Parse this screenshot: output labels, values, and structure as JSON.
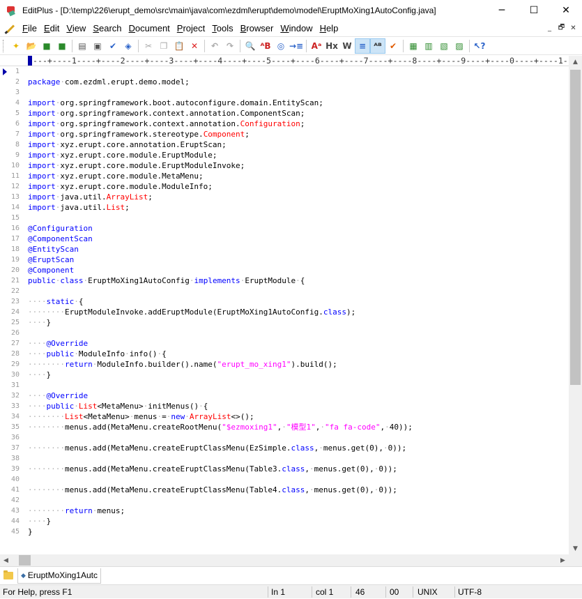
{
  "window": {
    "title": "EditPlus - [D:\\temp\\226\\erupt_demo\\src\\main\\java\\com\\ezdml\\erupt\\demo\\model\\EruptMoXing1AutoConfig.java]",
    "minimize": "─",
    "maximize": "☐",
    "close": "✕"
  },
  "menu": {
    "items": [
      {
        "u": "F",
        "rest": "ile"
      },
      {
        "u": "E",
        "rest": "dit"
      },
      {
        "u": "V",
        "rest": "iew"
      },
      {
        "u": "S",
        "rest": "earch"
      },
      {
        "u": "D",
        "rest": "ocument"
      },
      {
        "u": "P",
        "rest": "roject"
      },
      {
        "u": "T",
        "rest": "ools"
      },
      {
        "u": "B",
        "rest": "rowser"
      },
      {
        "u": "W",
        "rest": "indow"
      },
      {
        "u": "H",
        "rest": "elp"
      }
    ],
    "mdi": [
      "_",
      "🗗",
      "✕"
    ]
  },
  "toolbar": {
    "buttons": [
      {
        "icon": "new-file-icon",
        "glyph": "✦",
        "color": "#e8b800"
      },
      {
        "icon": "open-folder-icon",
        "glyph": "📂",
        "color": "#e0a020"
      },
      {
        "icon": "save-icon",
        "glyph": "■",
        "color": "#2b8a2b"
      },
      {
        "icon": "save-all-icon",
        "glyph": "■",
        "color": "#2b8a2b"
      },
      {
        "sep": true
      },
      {
        "icon": "print-preview-icon",
        "glyph": "▤",
        "color": "#555"
      },
      {
        "icon": "print-icon",
        "glyph": "▣",
        "color": "#555"
      },
      {
        "icon": "spell-check-icon",
        "glyph": "✔",
        "color": "#2a62c9"
      },
      {
        "icon": "browser-view-icon",
        "glyph": "◈",
        "color": "#2a62c9"
      },
      {
        "sep": true
      },
      {
        "icon": "cut-icon",
        "glyph": "✂",
        "color": "#aaa"
      },
      {
        "icon": "copy-icon",
        "glyph": "❐",
        "color": "#aaa"
      },
      {
        "icon": "paste-icon",
        "glyph": "📋",
        "color": "#aaa"
      },
      {
        "icon": "delete-icon",
        "glyph": "✕",
        "color": "#d22"
      },
      {
        "sep": true
      },
      {
        "icon": "undo-icon",
        "glyph": "↶",
        "color": "#aaa"
      },
      {
        "icon": "redo-icon",
        "glyph": "↷",
        "color": "#aaa"
      },
      {
        "sep": true
      },
      {
        "icon": "find-icon",
        "glyph": "🔍",
        "color": "#333"
      },
      {
        "icon": "replace-icon",
        "glyph": "ᴬB",
        "color": "#c22"
      },
      {
        "icon": "find-in-files-icon",
        "glyph": "◎",
        "color": "#2a62c9"
      },
      {
        "icon": "goto-line-icon",
        "glyph": "→≡",
        "color": "#2a62c9"
      },
      {
        "sep": true
      },
      {
        "icon": "font-icon",
        "glyph": "Aᵃ",
        "color": "#c22"
      },
      {
        "icon": "hex-view-icon",
        "glyph": "Hx",
        "color": "#444"
      },
      {
        "icon": "word-wrap-icon",
        "glyph": "W",
        "color": "#444"
      },
      {
        "icon": "line-number-icon",
        "glyph": "≡",
        "color": "#2a62c9",
        "active": true
      },
      {
        "icon": "column-marker-icon",
        "glyph": "ᴬᴮ",
        "color": "#333",
        "active": true
      },
      {
        "icon": "check-icon",
        "glyph": "✔",
        "color": "#e05a00"
      },
      {
        "sep": true
      },
      {
        "icon": "cliptext-icon",
        "glyph": "▦",
        "color": "#2b8a2b"
      },
      {
        "icon": "directory-icon",
        "glyph": "▥",
        "color": "#2b8a2b"
      },
      {
        "icon": "html-toolbar-icon",
        "glyph": "▧",
        "color": "#2b8a2b"
      },
      {
        "icon": "window-list-icon",
        "glyph": "▨",
        "color": "#2b8a2b"
      },
      {
        "sep": true
      },
      {
        "icon": "context-help-icon",
        "glyph": "↖?",
        "color": "#2a62c9"
      }
    ]
  },
  "ruler": "----+----1----+----2----+----3----+----4----+----5----+----6----+----7----+----8----+----9----+----0----+----1-",
  "code_lines": [
    [],
    [
      [
        "k",
        "package"
      ],
      [
        "d",
        "·"
      ],
      [
        "t",
        "com.ezdml.erupt.demo.model;"
      ]
    ],
    [],
    [
      [
        "k",
        "import"
      ],
      [
        "d",
        "·"
      ],
      [
        "t",
        "org.springframework.boot.autoconfigure.domain.EntityScan;"
      ]
    ],
    [
      [
        "k",
        "import"
      ],
      [
        "d",
        "·"
      ],
      [
        "t",
        "org.springframework.context.annotation.ComponentScan;"
      ]
    ],
    [
      [
        "k",
        "import"
      ],
      [
        "d",
        "·"
      ],
      [
        "t",
        "org.springframework.context.annotation."
      ],
      [
        "r",
        "Configuration"
      ],
      [
        "t",
        ";"
      ]
    ],
    [
      [
        "k",
        "import"
      ],
      [
        "d",
        "·"
      ],
      [
        "t",
        "org.springframework.stereotype."
      ],
      [
        "r",
        "Component"
      ],
      [
        "t",
        ";"
      ]
    ],
    [
      [
        "k",
        "import"
      ],
      [
        "d",
        "·"
      ],
      [
        "t",
        "xyz.erupt.core.annotation.EruptScan;"
      ]
    ],
    [
      [
        "k",
        "import"
      ],
      [
        "d",
        "·"
      ],
      [
        "t",
        "xyz.erupt.core.module.EruptModule;"
      ]
    ],
    [
      [
        "k",
        "import"
      ],
      [
        "d",
        "·"
      ],
      [
        "t",
        "xyz.erupt.core.module.EruptModuleInvoke;"
      ]
    ],
    [
      [
        "k",
        "import"
      ],
      [
        "d",
        "·"
      ],
      [
        "t",
        "xyz.erupt.core.module.MetaMenu;"
      ]
    ],
    [
      [
        "k",
        "import"
      ],
      [
        "d",
        "·"
      ],
      [
        "t",
        "xyz.erupt.core.module.ModuleInfo;"
      ]
    ],
    [
      [
        "k",
        "import"
      ],
      [
        "d",
        "·"
      ],
      [
        "t",
        "java.util."
      ],
      [
        "r",
        "ArrayList"
      ],
      [
        "t",
        ";"
      ]
    ],
    [
      [
        "k",
        "import"
      ],
      [
        "d",
        "·"
      ],
      [
        "t",
        "java.util."
      ],
      [
        "r",
        "List"
      ],
      [
        "t",
        ";"
      ]
    ],
    [],
    [
      [
        "k",
        "@Configuration"
      ]
    ],
    [
      [
        "k",
        "@ComponentScan"
      ]
    ],
    [
      [
        "k",
        "@EntityScan"
      ]
    ],
    [
      [
        "k",
        "@EruptScan"
      ]
    ],
    [
      [
        "k",
        "@Component"
      ]
    ],
    [
      [
        "k",
        "public"
      ],
      [
        "d",
        "·"
      ],
      [
        "k",
        "class"
      ],
      [
        "d",
        "·"
      ],
      [
        "t",
        "EruptMoXing1AutoConfig"
      ],
      [
        "d",
        "·"
      ],
      [
        "k",
        "implements"
      ],
      [
        "d",
        "·"
      ],
      [
        "t",
        "EruptModule"
      ],
      [
        "d",
        "·"
      ],
      [
        "t",
        "{"
      ]
    ],
    [],
    [
      [
        "d",
        "····"
      ],
      [
        "k",
        "static"
      ],
      [
        "d",
        "·"
      ],
      [
        "t",
        "{"
      ]
    ],
    [
      [
        "d",
        "········"
      ],
      [
        "t",
        "EruptModuleInvoke.addEruptModule(EruptMoXing1AutoConfig."
      ],
      [
        "k",
        "class"
      ],
      [
        "t",
        ");"
      ]
    ],
    [
      [
        "d",
        "····"
      ],
      [
        "t",
        "}"
      ]
    ],
    [],
    [
      [
        "d",
        "····"
      ],
      [
        "k",
        "@Override"
      ]
    ],
    [
      [
        "d",
        "····"
      ],
      [
        "k",
        "public"
      ],
      [
        "d",
        "·"
      ],
      [
        "t",
        "ModuleInfo"
      ],
      [
        "d",
        "·"
      ],
      [
        "t",
        "info()"
      ],
      [
        "d",
        "·"
      ],
      [
        "t",
        "{"
      ]
    ],
    [
      [
        "d",
        "········"
      ],
      [
        "k",
        "return"
      ],
      [
        "d",
        "·"
      ],
      [
        "t",
        "ModuleInfo.builder().name("
      ],
      [
        "s",
        "\"erupt_mo_xing1\""
      ],
      [
        "t",
        ").build();"
      ]
    ],
    [
      [
        "d",
        "····"
      ],
      [
        "t",
        "}"
      ]
    ],
    [],
    [
      [
        "d",
        "····"
      ],
      [
        "k",
        "@Override"
      ]
    ],
    [
      [
        "d",
        "····"
      ],
      [
        "k",
        "public"
      ],
      [
        "d",
        "·"
      ],
      [
        "r",
        "List"
      ],
      [
        "t",
        "<MetaMenu>"
      ],
      [
        "d",
        "·"
      ],
      [
        "t",
        "initMenus()"
      ],
      [
        "d",
        "·"
      ],
      [
        "t",
        "{"
      ]
    ],
    [
      [
        "d",
        "········"
      ],
      [
        "r",
        "List"
      ],
      [
        "t",
        "<MetaMenu>"
      ],
      [
        "d",
        "·"
      ],
      [
        "t",
        "menus"
      ],
      [
        "d",
        "·"
      ],
      [
        "t",
        "="
      ],
      [
        "d",
        "·"
      ],
      [
        "k",
        "new"
      ],
      [
        "d",
        "·"
      ],
      [
        "r",
        "ArrayList"
      ],
      [
        "t",
        "<>();"
      ]
    ],
    [
      [
        "d",
        "········"
      ],
      [
        "t",
        "menus.add(MetaMenu.createRootMenu("
      ],
      [
        "s",
        "\"$ezmoxing1\""
      ],
      [
        "t",
        ","
      ],
      [
        "d",
        "·"
      ],
      [
        "s",
        "\"模型1\""
      ],
      [
        "t",
        ","
      ],
      [
        "d",
        "·"
      ],
      [
        "s",
        "\"fa fa-code\""
      ],
      [
        "t",
        ","
      ],
      [
        "d",
        "·"
      ],
      [
        "t",
        "40));"
      ]
    ],
    [],
    [
      [
        "d",
        "········"
      ],
      [
        "t",
        "menus.add(MetaMenu.createEruptClassMenu(EzSimple."
      ],
      [
        "k",
        "class"
      ],
      [
        "t",
        ","
      ],
      [
        "d",
        "·"
      ],
      [
        "t",
        "menus.get(0),"
      ],
      [
        "d",
        "·"
      ],
      [
        "t",
        "0));"
      ]
    ],
    [],
    [
      [
        "d",
        "········"
      ],
      [
        "t",
        "menus.add(MetaMenu.createEruptClassMenu(Table3."
      ],
      [
        "k",
        "class"
      ],
      [
        "t",
        ","
      ],
      [
        "d",
        "·"
      ],
      [
        "t",
        "menus.get(0),"
      ],
      [
        "d",
        "·"
      ],
      [
        "t",
        "0));"
      ]
    ],
    [],
    [
      [
        "d",
        "········"
      ],
      [
        "t",
        "menus.add(MetaMenu.createEruptClassMenu(Table4."
      ],
      [
        "k",
        "class"
      ],
      [
        "t",
        ","
      ],
      [
        "d",
        "·"
      ],
      [
        "t",
        "menus.get(0),"
      ],
      [
        "d",
        "·"
      ],
      [
        "t",
        "0));"
      ]
    ],
    [],
    [
      [
        "d",
        "········"
      ],
      [
        "k",
        "return"
      ],
      [
        "d",
        "·"
      ],
      [
        "t",
        "menus;"
      ]
    ],
    [
      [
        "d",
        "····"
      ],
      [
        "t",
        "}"
      ]
    ],
    [
      [
        "t",
        "}"
      ]
    ]
  ],
  "tabs": [
    {
      "label": "EruptMoXing1Autc"
    }
  ],
  "status": {
    "help": "For Help, press F1",
    "line": "In 1",
    "col": "col 1",
    "num1": "46",
    "num2": "00",
    "eol": "UNIX",
    "encoding": "UTF-8"
  },
  "scroll": {
    "up": "▲",
    "down": "▼",
    "left": "◀",
    "right": "▶"
  }
}
